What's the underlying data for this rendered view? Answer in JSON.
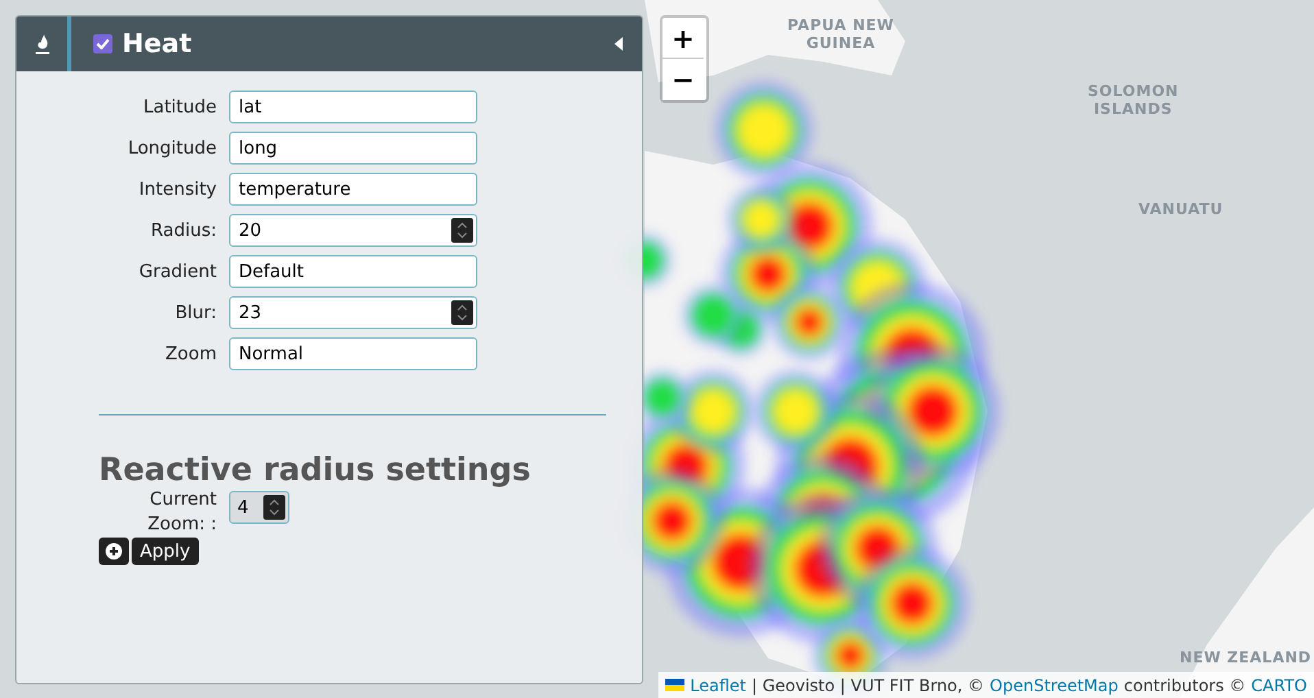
{
  "map": {
    "zoom_in": "+",
    "zoom_out": "−",
    "labels": [
      {
        "text": "PAPUA NEW\nGUINEA",
        "kind": "country"
      },
      {
        "text": "SOLOMON\nISLANDS",
        "kind": "country"
      },
      {
        "text": "VANUATU",
        "kind": "country"
      },
      {
        "text": "NEW ZEALAND",
        "kind": "country"
      }
    ]
  },
  "panel": {
    "title": "Heat",
    "enabled": true,
    "fields": [
      {
        "label": "Latitude",
        "value": "lat",
        "kind": "text"
      },
      {
        "label": "Longitude",
        "value": "long",
        "kind": "text"
      },
      {
        "label": "Intensity",
        "value": "temperature",
        "kind": "text"
      },
      {
        "label": "Radius:",
        "value": "20",
        "kind": "number"
      },
      {
        "label": "Gradient",
        "value": "Default",
        "kind": "text"
      },
      {
        "label": "Blur:",
        "value": "23",
        "kind": "number"
      },
      {
        "label": "Zoom",
        "value": "Normal",
        "kind": "text"
      }
    ],
    "section_title": "Reactive radius settings",
    "zoom_field": {
      "label": "Current Zoom: :",
      "value": "4"
    },
    "apply_button": "Apply"
  },
  "attribution": [
    {
      "text": "Leaflet",
      "kind": "link"
    },
    {
      "text": "| Geovisto | VUT FIT Brno, ©",
      "kind": "text"
    },
    {
      "text": "OpenStreetMap",
      "kind": "link"
    },
    {
      "text": "contributors ©",
      "kind": "text"
    },
    {
      "text": "CARTO",
      "kind": "link"
    }
  ]
}
